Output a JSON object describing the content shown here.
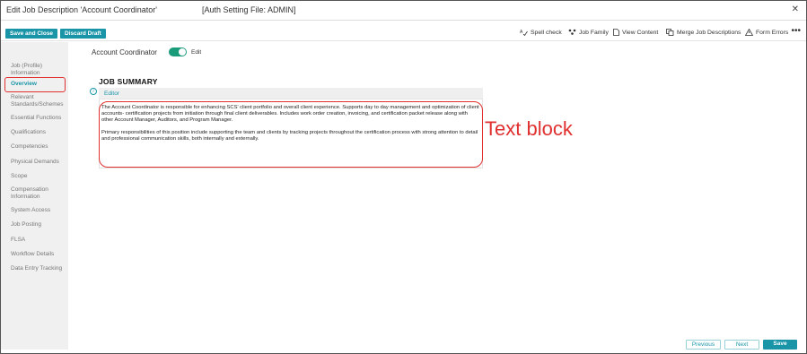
{
  "window": {
    "title": "Edit Job Description 'Account Coordinator'",
    "auth_setting": "[Auth Setting File: ADMIN]",
    "close_icon": "close-icon"
  },
  "toolbar": {
    "save_close_label": "Save and Close",
    "discard_label": "Discard Draft",
    "spell_check_label": "Spell check",
    "job_family_label": "Job Family",
    "view_content_label": "View Content",
    "merge_label": "Merge Job Descriptions",
    "form_errors_label": "Form Errors",
    "more_glyph": "•••"
  },
  "sidebar": {
    "items": [
      {
        "label": "Job (Profile)",
        "label2": "Information",
        "active": false
      },
      {
        "label": "Overview",
        "active": true
      },
      {
        "label": "Relevant",
        "label2": "Standards/Schemes",
        "active": false
      },
      {
        "label": "Essential Functions",
        "active": false
      },
      {
        "label": "Qualifications",
        "active": false
      },
      {
        "label": "Competencies",
        "active": false
      },
      {
        "label": "Physical Demands",
        "active": false
      },
      {
        "label": "Scope",
        "active": false
      },
      {
        "label": "Compensation",
        "label2": "Information",
        "active": false
      },
      {
        "label": "System Access",
        "active": false
      },
      {
        "label": "Job Posting",
        "active": false
      },
      {
        "label": "FLSA",
        "active": false
      },
      {
        "label": "Workflow Details",
        "active": false
      },
      {
        "label": "Data Entry Tracking",
        "active": false
      }
    ]
  },
  "main": {
    "role_name": "Account Coordinator",
    "edit_toggle_label": "Edit",
    "edit_toggle_on": true,
    "section_title": "JOB SUMMARY",
    "info_glyph": "i",
    "editor_label": "Editor",
    "paragraph1": "The Account Coordinator is responsible for enhancing SCS' client portfolio and overall client experience. Supports day to day management and optimization of client accounts- certification projects from initiation through final client deliverables.  Includes work order creation, invoicing, and certification packet release along with other Account Manager, Auditors, and Program Manager.",
    "paragraph2": "Primary responsibilities of this position include supporting the team and clients by tracking projects throughout the certification process with strong attention to detail and professional communication skills, both internally and externally.",
    "annotation": "Text block"
  },
  "footer": {
    "previous_label": "Previous",
    "next_label": "Next",
    "save_label": "Save"
  },
  "colors": {
    "accent": "#1a95a8",
    "toggle": "#1a9b7a",
    "annotation": "#e03030"
  }
}
